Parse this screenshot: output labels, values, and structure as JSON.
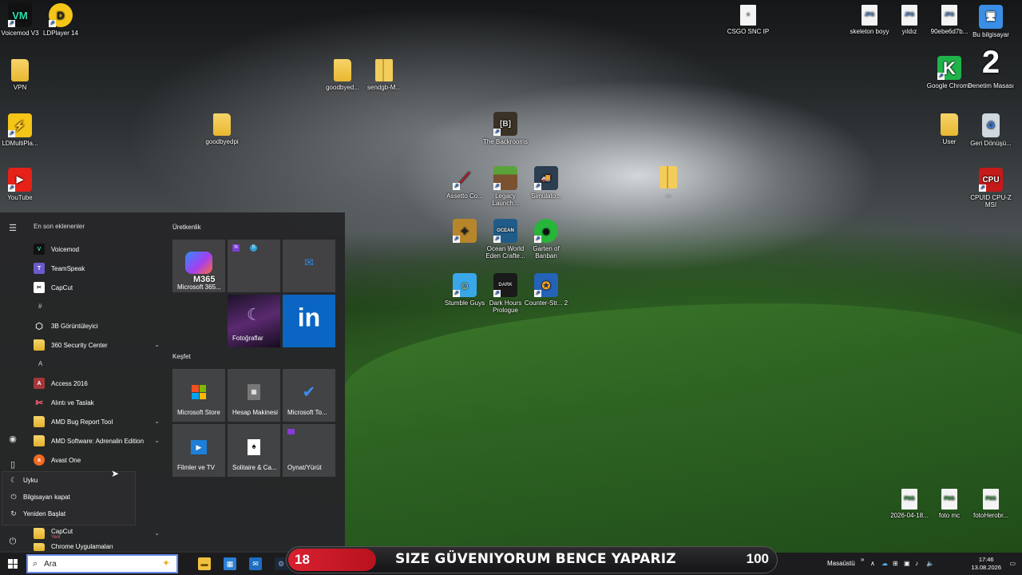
{
  "desktop_icons": [
    {
      "label": "Voicemod V3"
    },
    {
      "label": "LDPlayer 14"
    },
    {
      "label": "VPN"
    },
    {
      "label": "LDMultiPla..."
    },
    {
      "label": "YouTube"
    },
    {
      "label": "goodbyed..."
    },
    {
      "label": "sendgb-M..."
    },
    {
      "label": "goodbyedpi"
    },
    {
      "label": "The Backrooms"
    },
    {
      "label": "Assetto Co..."
    },
    {
      "label": "Legacy Launch..."
    },
    {
      "label": "Simulato..."
    },
    {
      "label": "..."
    },
    {
      "label": "Ocean World Eden Crafte..."
    },
    {
      "label": "Garten of Banban"
    },
    {
      "label": "Stumble Guys"
    },
    {
      "label": "Dark Hours Prologue"
    },
    {
      "label": "Counter-Str... 2"
    },
    {
      "label": "CSGO SNC IP"
    },
    {
      "label": "skeleton boyy"
    },
    {
      "label": "yıldız"
    },
    {
      "label": "90ebe6d7b..."
    },
    {
      "label": "Bu bilgisayar"
    },
    {
      "label": "Google Chrome"
    },
    {
      "label": "Denetim Masası"
    },
    {
      "label": "User"
    },
    {
      "label": "Geri Dönüşü..."
    },
    {
      "label": "CPUID CPU-Z MSI"
    },
    {
      "label": "2026-04-18..."
    },
    {
      "label": "foto mc"
    },
    {
      "label": "fotoHerobr..."
    }
  ],
  "start_menu": {
    "recent_label": "En son eklenenler",
    "apps": [
      {
        "label": "Voicemod"
      },
      {
        "label": "TeamSpeak"
      },
      {
        "label": "CapCut"
      },
      {
        "letter": "#"
      },
      {
        "label": "3B Görüntüleyici"
      },
      {
        "label": "360 Security Center"
      },
      {
        "letter": "A"
      },
      {
        "label": "Access 2016"
      },
      {
        "label": "Alıntı ve Taslak"
      },
      {
        "label": "AMD Bug Report Tool"
      },
      {
        "label": "AMD Software: Adrenalin Edition"
      },
      {
        "label": "Avast One"
      }
    ],
    "capcut_folder": {
      "label": "CapCut",
      "sub": "Yeni"
    },
    "chrome_folder": {
      "label": "Chrome Uygulamaları"
    },
    "productivity_label": "Üretkenlik",
    "tiles_productivity": [
      {
        "label": "Microsoft 365...",
        "badge": "M365"
      },
      {
        "label": ""
      },
      {
        "label": ""
      },
      {
        "label": "Fotoğraflar"
      },
      {
        "label": "in"
      }
    ],
    "explore_label": "Keşfet",
    "tiles_explore": [
      {
        "label": "Microsoft Store"
      },
      {
        "label": "Hesap Makinesi"
      },
      {
        "label": "Microsoft To..."
      },
      {
        "label": "Filmler ve TV"
      },
      {
        "label": "Solitaire & Ca..."
      },
      {
        "label": "Oynat/Yürüt"
      }
    ]
  },
  "power_menu": {
    "items": [
      {
        "label": "Uyku"
      },
      {
        "label": "Bilgisayarı kapat"
      },
      {
        "label": "Yeniden Başlat"
      }
    ]
  },
  "taskbar": {
    "search_placeholder": "Ara",
    "desktop_label": "Masaüstü",
    "time": "17:46",
    "date": "13.08.2026"
  },
  "banner": {
    "count": "18",
    "message": "SIZE GÜVENIYORUM BENCE YAPARIZ",
    "goal": "100"
  }
}
